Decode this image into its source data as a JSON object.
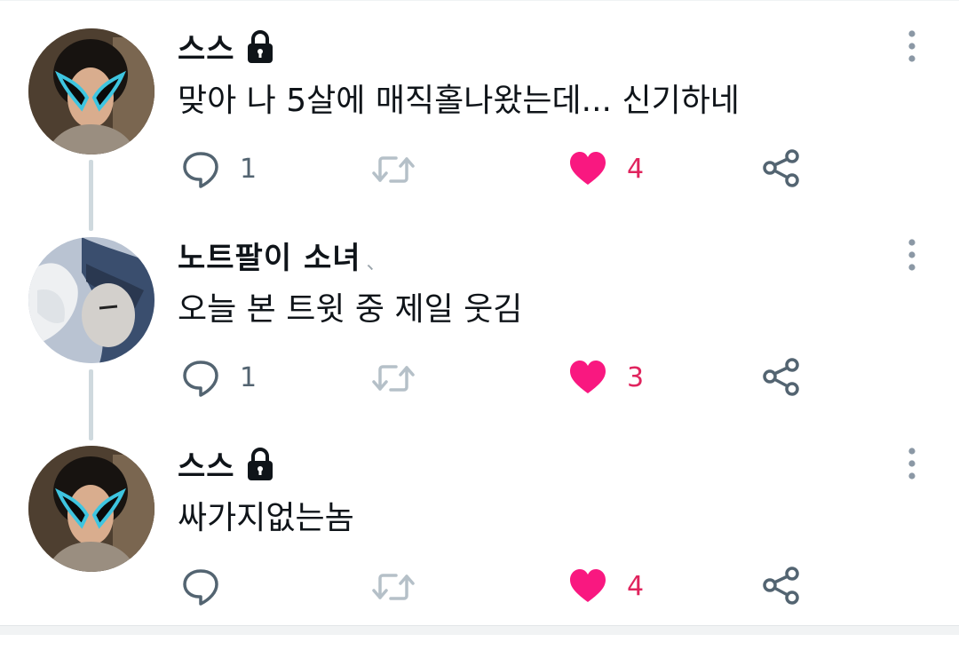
{
  "colors": {
    "text": "#0f1419",
    "muted": "#536471",
    "like": "#f91880",
    "like_count": "#e0245e",
    "thread_line": "#cfd9de"
  },
  "icons": {
    "reply": "speech-bubble-icon",
    "retweet": "retweet-icon",
    "like": "heart-icon",
    "share": "share-icon",
    "more": "vertical-ellipsis-icon",
    "lock": "lock-icon"
  },
  "tweets": [
    {
      "name": "스스",
      "locked": true,
      "text": "맞아 나 5살에 매직홀나왔는데... 신기하네",
      "reply_count": "1",
      "like_count": "4"
    },
    {
      "name": "노트팔이 소녀",
      "locked": false,
      "name_suffix": "、",
      "text": "오늘 본 트윗 중 제일 웃김",
      "reply_count": "1",
      "like_count": "3"
    },
    {
      "name": "스스",
      "locked": true,
      "text": "싸가지없는놈",
      "reply_count": "",
      "like_count": "4"
    }
  ]
}
